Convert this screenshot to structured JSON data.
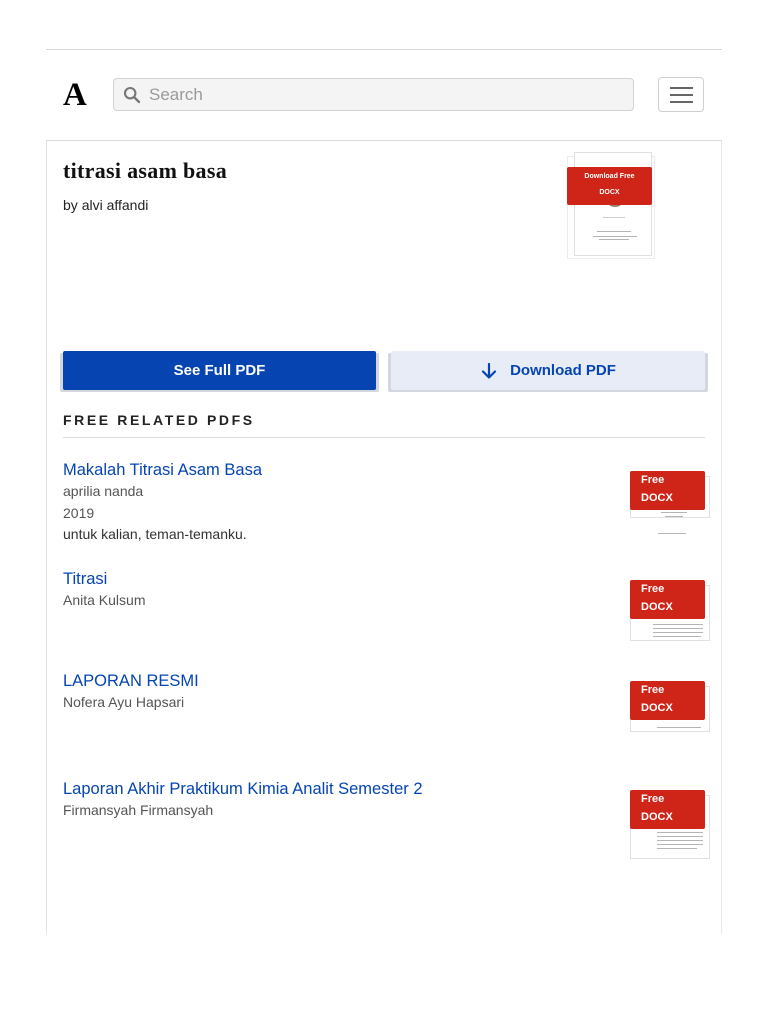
{
  "header": {
    "logo": "A",
    "search_placeholder": "Search",
    "icons": {
      "search": "search-icon",
      "menu": "hamburger-menu-icon"
    }
  },
  "document": {
    "title": "titrasi asam basa",
    "author_prefix": "by",
    "author": "alvi affandi",
    "thumbnail_badge": {
      "line1": "Download Free",
      "line2": "DOCX"
    }
  },
  "actions": {
    "see_full": "See Full PDF",
    "download": "Download PDF",
    "download_icon": "arrow-down-icon"
  },
  "related": {
    "heading": "FREE RELATED PDFS",
    "items": [
      {
        "title": "Makalah Titrasi Asam Basa",
        "author": "aprilia nanda",
        "year": "2019",
        "snippet": "untuk kalian, teman-temanku.",
        "badge": {
          "line1": "Free",
          "line2": "DOCX"
        }
      },
      {
        "title": "Titrasi",
        "author": "Anita Kulsum",
        "badge": {
          "line1": "Free",
          "line2": "DOCX"
        }
      },
      {
        "title": "LAPORAN RESMI",
        "author": "Nofera Ayu Hapsari",
        "badge": {
          "line1": "Free",
          "line2": "DOCX"
        }
      },
      {
        "title": "Laporan Akhir Praktikum Kimia Analit Semester 2",
        "author": "Firmansyah Firmansyah",
        "badge": {
          "line1": "Free",
          "line2": "DOCX"
        }
      }
    ]
  },
  "colors": {
    "primary": "#0645b1",
    "badge": "#cf2418",
    "secondary_bg": "#e7ecf6"
  }
}
